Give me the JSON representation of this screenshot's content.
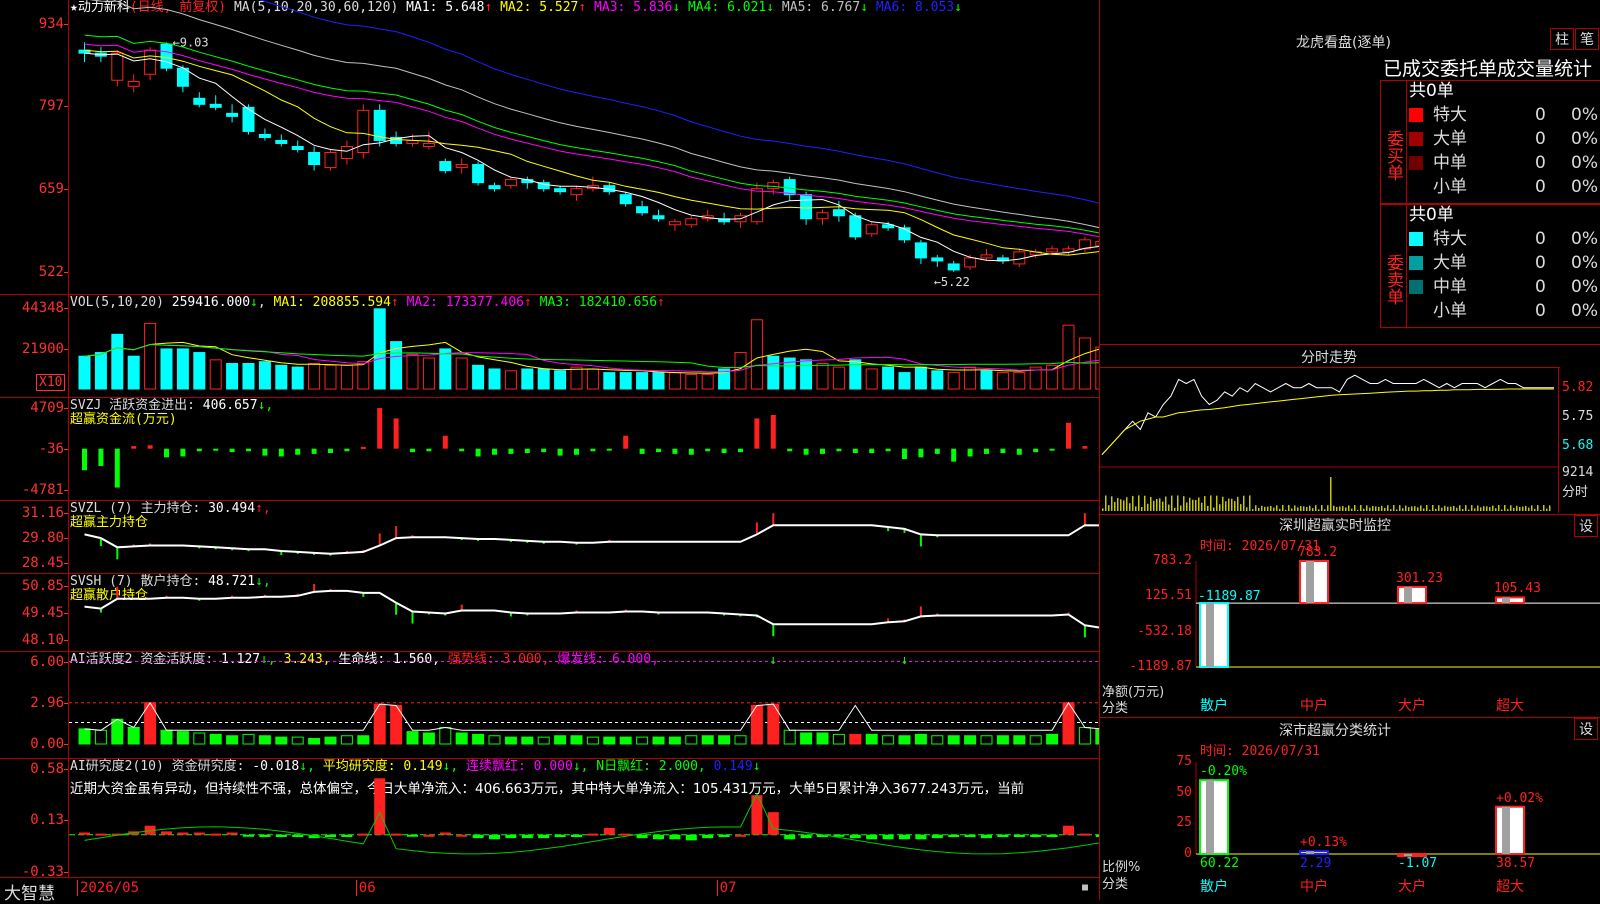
{
  "stock": {
    "name": "★动力新科",
    "mode": "(日线, 前复权)"
  },
  "colors": {
    "up": "#ff2020",
    "down": "#00ffff",
    "ma1": "#ffffff",
    "ma2": "#ffff00",
    "ma3": "#ff00ff",
    "ma4": "#00ff00",
    "ma5": "#c0c0c0",
    "ma6": "#2020ff",
    "grid": "#b00000"
  },
  "kline": {
    "ma_label": "MA(5,10,20,30,60,120)",
    "ma": [
      {
        "label": "MA1:",
        "value": "5.648",
        "arrow": "↑",
        "color": "#ffffff"
      },
      {
        "label": "MA2:",
        "value": "5.527",
        "arrow": "↑",
        "color": "#ffff00"
      },
      {
        "label": "MA3:",
        "value": "5.836",
        "arrow": "↓",
        "color": "#ff00ff"
      },
      {
        "label": "MA4:",
        "value": "6.021",
        "arrow": "↓",
        "color": "#00ff00"
      },
      {
        "label": "MA5:",
        "value": "6.767",
        "arrow": "↓",
        "color": "#c0c0c0"
      },
      {
        "label": "MA6:",
        "value": "8.053",
        "arrow": "↓",
        "color": "#2020ff"
      }
    ],
    "y_ticks": [
      "934",
      "797",
      "659",
      "522"
    ],
    "high_label": "9.03",
    "low_label": "5.22",
    "y_range": [
      5.0,
      9.5
    ],
    "candles": [
      [
        8.9,
        9.03,
        8.7,
        8.85
      ],
      [
        8.85,
        8.95,
        8.7,
        8.8
      ],
      [
        8.4,
        8.9,
        8.3,
        8.85
      ],
      [
        8.3,
        8.5,
        8.2,
        8.38
      ],
      [
        8.5,
        8.95,
        8.4,
        8.9
      ],
      [
        9.0,
        9.03,
        8.55,
        8.6
      ],
      [
        8.6,
        8.65,
        8.2,
        8.3
      ],
      [
        8.1,
        8.2,
        7.95,
        8.0
      ],
      [
        8.0,
        8.15,
        7.9,
        7.95
      ],
      [
        7.85,
        8.0,
        7.7,
        7.8
      ],
      [
        7.95,
        8.0,
        7.5,
        7.55
      ],
      [
        7.5,
        7.6,
        7.4,
        7.45
      ],
      [
        7.4,
        7.5,
        7.3,
        7.35
      ],
      [
        7.3,
        7.4,
        7.2,
        7.25
      ],
      [
        7.2,
        7.3,
        6.9,
        7.0
      ],
      [
        6.95,
        7.25,
        6.9,
        7.2
      ],
      [
        7.1,
        7.4,
        7.0,
        7.3
      ],
      [
        7.2,
        8.0,
        7.1,
        7.9
      ],
      [
        7.9,
        8.0,
        7.3,
        7.4
      ],
      [
        7.45,
        7.55,
        7.3,
        7.35
      ],
      [
        7.35,
        7.5,
        7.3,
        7.4
      ],
      [
        7.3,
        7.55,
        7.25,
        7.35
      ],
      [
        7.05,
        7.1,
        6.85,
        6.9
      ],
      [
        6.95,
        7.1,
        6.85,
        7.0
      ],
      [
        7.0,
        7.05,
        6.65,
        6.7
      ],
      [
        6.65,
        6.7,
        6.55,
        6.6
      ],
      [
        6.65,
        6.8,
        6.6,
        6.75
      ],
      [
        6.75,
        6.8,
        6.6,
        6.7
      ],
      [
        6.7,
        6.75,
        6.55,
        6.6
      ],
      [
        6.6,
        6.65,
        6.5,
        6.55
      ],
      [
        6.5,
        6.65,
        6.4,
        6.6
      ],
      [
        6.6,
        6.8,
        6.55,
        6.65
      ],
      [
        6.65,
        6.7,
        6.5,
        6.55
      ],
      [
        6.5,
        6.55,
        6.3,
        6.35
      ],
      [
        6.3,
        6.4,
        6.15,
        6.2
      ],
      [
        6.15,
        6.25,
        6.05,
        6.1
      ],
      [
        6.0,
        6.1,
        5.9,
        6.05
      ],
      [
        6.0,
        6.15,
        5.95,
        6.1
      ],
      [
        6.1,
        6.25,
        6.05,
        6.15
      ],
      [
        6.1,
        6.2,
        6.0,
        6.05
      ],
      [
        6.05,
        6.2,
        5.95,
        6.15
      ],
      [
        6.05,
        6.7,
        6.0,
        6.6
      ],
      [
        6.6,
        6.75,
        6.5,
        6.7
      ],
      [
        6.75,
        6.8,
        6.4,
        6.5
      ],
      [
        6.5,
        6.55,
        6.0,
        6.1
      ],
      [
        6.1,
        6.25,
        6.0,
        6.2
      ],
      [
        6.25,
        6.4,
        6.05,
        6.15
      ],
      [
        6.15,
        6.2,
        5.75,
        5.8
      ],
      [
        5.85,
        6.05,
        5.8,
        6.0
      ],
      [
        6.0,
        6.05,
        5.9,
        5.95
      ],
      [
        5.95,
        6.0,
        5.7,
        5.75
      ],
      [
        5.7,
        5.75,
        5.35,
        5.45
      ],
      [
        5.45,
        5.5,
        5.3,
        5.4
      ],
      [
        5.35,
        5.4,
        5.22,
        5.25
      ],
      [
        5.3,
        5.5,
        5.25,
        5.45
      ],
      [
        5.45,
        5.6,
        5.4,
        5.5
      ],
      [
        5.45,
        5.5,
        5.35,
        5.4
      ],
      [
        5.35,
        5.6,
        5.3,
        5.55
      ],
      [
        5.5,
        5.6,
        5.45,
        5.55
      ],
      [
        5.55,
        5.65,
        5.5,
        5.6
      ],
      [
        5.55,
        5.65,
        5.5,
        5.6
      ],
      [
        5.6,
        5.8,
        5.55,
        5.75
      ],
      [
        5.65,
        5.8,
        5.6,
        5.72
      ]
    ]
  },
  "vol": {
    "title": "VOL(5,10,20)",
    "value": "259416.000",
    "arrow": "↓",
    "ma": [
      {
        "label": "MA1:",
        "value": "208855.594",
        "arrow": "↑",
        "color": "#ffff00"
      },
      {
        "label": "MA2:",
        "value": "173377.406",
        "arrow": "↑",
        "color": "#ff00ff"
      },
      {
        "label": "MA3:",
        "value": "182410.656",
        "arrow": "↑",
        "color": "#00ff00"
      }
    ],
    "y_ticks": [
      "44348",
      "21900"
    ],
    "unit": "X10",
    "max": 45000,
    "values": [
      18000,
      20000,
      30000,
      18000,
      36000,
      22000,
      22000,
      20000,
      16000,
      14000,
      14000,
      15000,
      13000,
      12000,
      14000,
      13000,
      13000,
      15000,
      44000,
      26000,
      19000,
      17000,
      22000,
      17000,
      13000,
      11000,
      10000,
      11000,
      11000,
      10000,
      12000,
      11000,
      9000,
      9000,
      9000,
      9000,
      9000,
      8000,
      8000,
      11000,
      20000,
      38000,
      18000,
      17000,
      16000,
      14000,
      12000,
      16000,
      11000,
      12000,
      9000,
      12000,
      10000,
      9000,
      12000,
      10000,
      9000,
      9000,
      12000,
      13000,
      35000,
      28000,
      23000
    ],
    "up": [
      0,
      0,
      0,
      0,
      1,
      0,
      0,
      0,
      1,
      0,
      0,
      0,
      0,
      0,
      1,
      1,
      1,
      1,
      0,
      0,
      1,
      1,
      0,
      1,
      0,
      0,
      1,
      0,
      0,
      0,
      1,
      1,
      0,
      0,
      0,
      0,
      1,
      1,
      1,
      0,
      1,
      1,
      0,
      0,
      0,
      1,
      1,
      0,
      1,
      0,
      0,
      0,
      0,
      1,
      1,
      0,
      1,
      1,
      1,
      1,
      1,
      1,
      1
    ]
  },
  "svzj": {
    "title": "SVZJ",
    "label": "活跃资金进出:",
    "value": "406.657",
    "arrow": "↓,",
    "subtitle": "超赢资金流(万元)",
    "y_ticks": [
      "4709",
      "-36",
      "-4781"
    ],
    "range": [
      -4781,
      4709
    ],
    "values": [
      -2500,
      -2000,
      -4500,
      300,
      400,
      -1000,
      -900,
      -300,
      -200,
      -400,
      -300,
      -800,
      -900,
      -700,
      -600,
      -500,
      -300,
      200,
      4700,
      3500,
      -400,
      -300,
      1500,
      -300,
      -900,
      -700,
      -600,
      -500,
      -400,
      -800,
      -700,
      -300,
      -200,
      1500,
      -600,
      -400,
      -600,
      -700,
      -300,
      -500,
      -400,
      3500,
      3900,
      -300,
      -700,
      -600,
      -300,
      -500,
      -500,
      -300,
      -1200,
      -1000,
      -600,
      -1500,
      -900,
      -600,
      -500,
      -700,
      -400,
      -200,
      3000,
      300,
      300
    ]
  },
  "svzl": {
    "title": "SVZL (7)",
    "label": "主力持仓:",
    "value": "30.494",
    "arrow": "↑,",
    "subtitle": "超赢主力持仓",
    "y_ticks": [
      "31.16",
      "29.80",
      "28.45"
    ],
    "range": [
      28.45,
      31.16
    ],
    "values": [
      30.0,
      29.8,
      29.3,
      29.35,
      29.4,
      29.4,
      29.4,
      29.35,
      29.3,
      29.25,
      29.2,
      29.2,
      29.1,
      29.05,
      29.0,
      28.95,
      29.0,
      29.05,
      29.4,
      29.8,
      29.85,
      29.85,
      29.85,
      29.8,
      29.75,
      29.75,
      29.7,
      29.65,
      29.6,
      29.6,
      29.55,
      29.55,
      29.6,
      29.6,
      29.6,
      29.6,
      29.6,
      29.6,
      29.6,
      29.6,
      29.6,
      30.0,
      30.5,
      30.5,
      30.5,
      30.5,
      30.5,
      30.5,
      30.5,
      30.4,
      30.3,
      30.0,
      29.95,
      29.95,
      29.95,
      29.95,
      29.95,
      29.95,
      29.95,
      29.95,
      29.95,
      30.5,
      30.49
    ]
  },
  "svsh": {
    "title": "SVSH (7)",
    "label": "散户持仓:",
    "value": "48.721",
    "arrow": "↓,",
    "subtitle": "超赢散户持仓",
    "y_ticks": [
      "50.85",
      "49.45",
      "48.10"
    ],
    "range": [
      48.1,
      50.85
    ],
    "values": [
      49.8,
      49.7,
      50.2,
      50.2,
      50.2,
      50.25,
      50.25,
      50.2,
      50.2,
      50.25,
      50.25,
      50.3,
      50.3,
      50.35,
      50.55,
      50.6,
      50.6,
      50.5,
      50.5,
      50.0,
      49.55,
      49.5,
      49.45,
      49.6,
      49.6,
      49.6,
      49.5,
      49.45,
      49.45,
      49.45,
      49.5,
      49.5,
      49.5,
      49.55,
      49.55,
      49.5,
      49.5,
      49.5,
      49.5,
      49.45,
      49.4,
      49.35,
      48.9,
      48.9,
      48.9,
      48.9,
      48.9,
      48.9,
      48.9,
      49.0,
      49.05,
      49.3,
      49.35,
      49.35,
      49.35,
      49.35,
      49.35,
      49.35,
      49.35,
      49.35,
      49.4,
      48.85,
      48.72
    ]
  },
  "ai_active": {
    "title": "AI活跃度2",
    "label": "资金活跃度:",
    "value": "1.127",
    "arrow": "↓,",
    "v2": "3.243,",
    "life_label": "生命线:",
    "life_value": "1.560,",
    "strong_label": "强势线:",
    "strong_value": "3.000,",
    "burst_label": "爆发线:",
    "burst_value": "6.000,",
    "y_ticks": [
      "6.00",
      "2.96",
      "0.00"
    ],
    "range": [
      0,
      6.4
    ],
    "values": [
      1.1,
      1.0,
      1.8,
      1.2,
      3.0,
      1.0,
      0.9,
      0.8,
      0.7,
      0.6,
      0.7,
      0.6,
      0.5,
      0.5,
      0.4,
      0.5,
      0.6,
      0.6,
      2.9,
      2.8,
      0.9,
      0.8,
      1.2,
      0.8,
      0.7,
      0.6,
      0.5,
      0.5,
      0.5,
      0.6,
      0.6,
      0.5,
      0.5,
      0.5,
      0.5,
      0.5,
      0.5,
      0.6,
      0.6,
      0.6,
      0.6,
      2.8,
      2.9,
      1.0,
      0.8,
      0.8,
      0.7,
      0.7,
      0.7,
      0.6,
      0.6,
      0.7,
      0.6,
      0.6,
      0.6,
      0.6,
      0.6,
      0.6,
      0.6,
      0.7,
      3.0,
      1.2,
      1.1
    ],
    "red": [
      0,
      0,
      0,
      0,
      1,
      0,
      0,
      0,
      0,
      0,
      0,
      0,
      0,
      0,
      0,
      0,
      0,
      0,
      1,
      1,
      0,
      0,
      0,
      0,
      0,
      0,
      0,
      0,
      0,
      0,
      0,
      0,
      0,
      0,
      0,
      0,
      0,
      0,
      0,
      0,
      0,
      1,
      1,
      0,
      0,
      0,
      0,
      1,
      0,
      0,
      0,
      0,
      0,
      0,
      0,
      0,
      0,
      0,
      0,
      0,
      1,
      0,
      0
    ]
  },
  "ai_research": {
    "title": "AI研究度2(10)",
    "label": "资金研究度:",
    "value": "-0.018",
    "arrow": "↓,",
    "avg_label": "平均研究度:",
    "avg_value": "0.149",
    "avg_arrow": "↓,",
    "red_label": "连续飘红:",
    "red_value": "0.000",
    "red_arrow": "↓,",
    "nred_label": "N日飘红:",
    "nred_value": "2.000,",
    "last": "0.149",
    "last_arrow": "↓",
    "comment": "近期大资金虽有异动，但持续性不强，总体偏空，今日大单净流入：406.663万元，其中特大单净流入：105.431万元，大单5日累计净入3677.243万元，当前",
    "y_ticks": [
      "0.58",
      "0.13",
      "-0.33"
    ],
    "range": [
      -0.33,
      0.6
    ],
    "values": [
      0.02,
      0.01,
      0.01,
      0.03,
      0.08,
      0.03,
      0.02,
      0.02,
      0.01,
      0.02,
      -0.01,
      -0.02,
      -0.02,
      -0.02,
      -0.03,
      -0.02,
      -0.02,
      0.01,
      0.5,
      0.01,
      -0.01,
      0.0,
      0.02,
      0.0,
      -0.03,
      -0.04,
      -0.03,
      -0.03,
      -0.03,
      -0.02,
      -0.02,
      0.01,
      0.06,
      0.01,
      -0.03,
      -0.04,
      -0.04,
      -0.05,
      -0.03,
      -0.02,
      0.0,
      0.35,
      0.2,
      -0.04,
      -0.03,
      -0.02,
      -0.01,
      -0.03,
      -0.04,
      -0.04,
      -0.04,
      -0.04,
      -0.03,
      -0.02,
      -0.02,
      -0.03,
      -0.02,
      -0.02,
      -0.02,
      -0.02,
      0.08,
      0.01,
      -0.02
    ]
  },
  "xaxis": {
    "brand": "大智慧",
    "labels": [
      {
        "text": "2026/05",
        "i": 0
      },
      {
        "text": "06",
        "i": 17
      },
      {
        "text": "07",
        "i": 39
      }
    ]
  },
  "dragon": {
    "title": "龙虎看盘(逐单)",
    "btn1": "柱",
    "btn2": "笔",
    "subtitle": "已成交委托单成交量统计",
    "buy_side": "委买单",
    "sell_side": "委卖单",
    "buy_total": "共0单",
    "sell_total": "共0单",
    "buy_rows": [
      {
        "name": "特大",
        "count": "0",
        "pct": "0%",
        "color": "#ff0000"
      },
      {
        "name": "大单",
        "count": "0",
        "pct": "0%",
        "color": "#a00000"
      },
      {
        "name": "中单",
        "count": "0",
        "pct": "0%",
        "color": "#700000"
      },
      {
        "name": "小单",
        "count": "0",
        "pct": "0%",
        "color": ""
      }
    ],
    "sell_rows": [
      {
        "name": "特大",
        "count": "0",
        "pct": "0%",
        "color": "#00ffff"
      },
      {
        "name": "大单",
        "count": "0",
        "pct": "0%",
        "color": "#00a0a0"
      },
      {
        "name": "中单",
        "count": "0",
        "pct": "0%",
        "color": "#007070"
      },
      {
        "name": "小单",
        "count": "0",
        "pct": "0%",
        "color": ""
      }
    ]
  },
  "intraday": {
    "title": "分时走势",
    "y_ticks": [
      "5.82",
      "5.75",
      "5.68"
    ],
    "vol_tick": "9214",
    "vol_label": "分时",
    "range": [
      5.64,
      5.86
    ],
    "price": [
      5.66,
      5.68,
      5.7,
      5.72,
      5.74,
      5.72,
      5.76,
      5.75,
      5.78,
      5.8,
      5.84,
      5.83,
      5.84,
      5.8,
      5.78,
      5.79,
      5.81,
      5.8,
      5.82,
      5.81,
      5.83,
      5.82,
      5.81,
      5.82,
      5.83,
      5.82,
      5.82,
      5.83,
      5.82,
      5.82,
      5.82,
      5.81,
      5.84,
      5.85,
      5.84,
      5.83,
      5.83,
      5.84,
      5.83,
      5.83,
      5.83,
      5.83,
      5.84,
      5.83,
      5.82,
      5.83,
      5.82,
      5.83,
      5.83,
      5.83,
      5.82,
      5.83,
      5.84,
      5.83,
      5.83,
      5.82,
      5.82,
      5.82,
      5.82,
      5.82
    ],
    "avg": [
      5.66,
      5.68,
      5.7,
      5.72,
      5.73,
      5.74,
      5.745,
      5.75,
      5.75,
      5.755,
      5.76,
      5.762,
      5.765,
      5.767,
      5.768,
      5.77,
      5.772,
      5.775,
      5.778,
      5.78,
      5.782,
      5.784,
      5.786,
      5.788,
      5.79,
      5.792,
      5.794,
      5.796,
      5.798,
      5.8,
      5.802,
      5.803,
      5.804,
      5.805,
      5.806,
      5.807,
      5.808,
      5.809,
      5.81,
      5.811,
      5.812,
      5.812,
      5.813,
      5.813,
      5.814,
      5.814,
      5.815,
      5.815,
      5.815,
      5.816,
      5.816,
      5.816,
      5.816,
      5.817,
      5.817,
      5.817,
      5.817,
      5.817,
      5.817,
      5.817
    ]
  },
  "monitor": {
    "title": "深圳超赢实时监控",
    "btn": "设",
    "time": "时间: 2026/07/31",
    "y_ticks": [
      "783.2",
      "125.51",
      "-532.18",
      "-1189.87"
    ],
    "range": [
      -1189.87,
      783.2
    ],
    "ylabel": "净额(万元)",
    "xlabel": "分类",
    "bars": [
      {
        "name": "散户",
        "value": -1189.87,
        "label": "-1189.87",
        "color": "#00ffff"
      },
      {
        "name": "中户",
        "value": 783.2,
        "label": "783.2",
        "color": "#ff2020"
      },
      {
        "name": "大户",
        "value": 301.23,
        "label": "301.23",
        "color": "#ff2020"
      },
      {
        "name": "超大",
        "value": 105.43,
        "label": "105.43",
        "color": "#ff2020"
      }
    ]
  },
  "classify": {
    "title": "深市超赢分类统计",
    "btn": "设",
    "time": "时间: 2026/07/31",
    "y_ticks": [
      "75",
      "50",
      "25",
      "0"
    ],
    "range": [
      0,
      75
    ],
    "ylabel": "比例%",
    "xlabel": "分类",
    "bars": [
      {
        "name": "散户",
        "value": 60.22,
        "label": "60.22",
        "delta": "-0.20%",
        "dcolor": "#00ff00",
        "color": "#00ff00"
      },
      {
        "name": "中户",
        "value": 2.29,
        "label": "2.29",
        "delta": "+0.13%",
        "dcolor": "#ff2020",
        "color": "#2020ff"
      },
      {
        "name": "大户",
        "value": -1.07,
        "label": "-1.07",
        "delta": "",
        "dcolor": "#ff2020",
        "color": "#ff2020"
      },
      {
        "name": "超大",
        "value": 38.57,
        "label": "38.57",
        "delta": "+0.02%",
        "dcolor": "#ff2020",
        "color": "#ff2020"
      }
    ]
  }
}
